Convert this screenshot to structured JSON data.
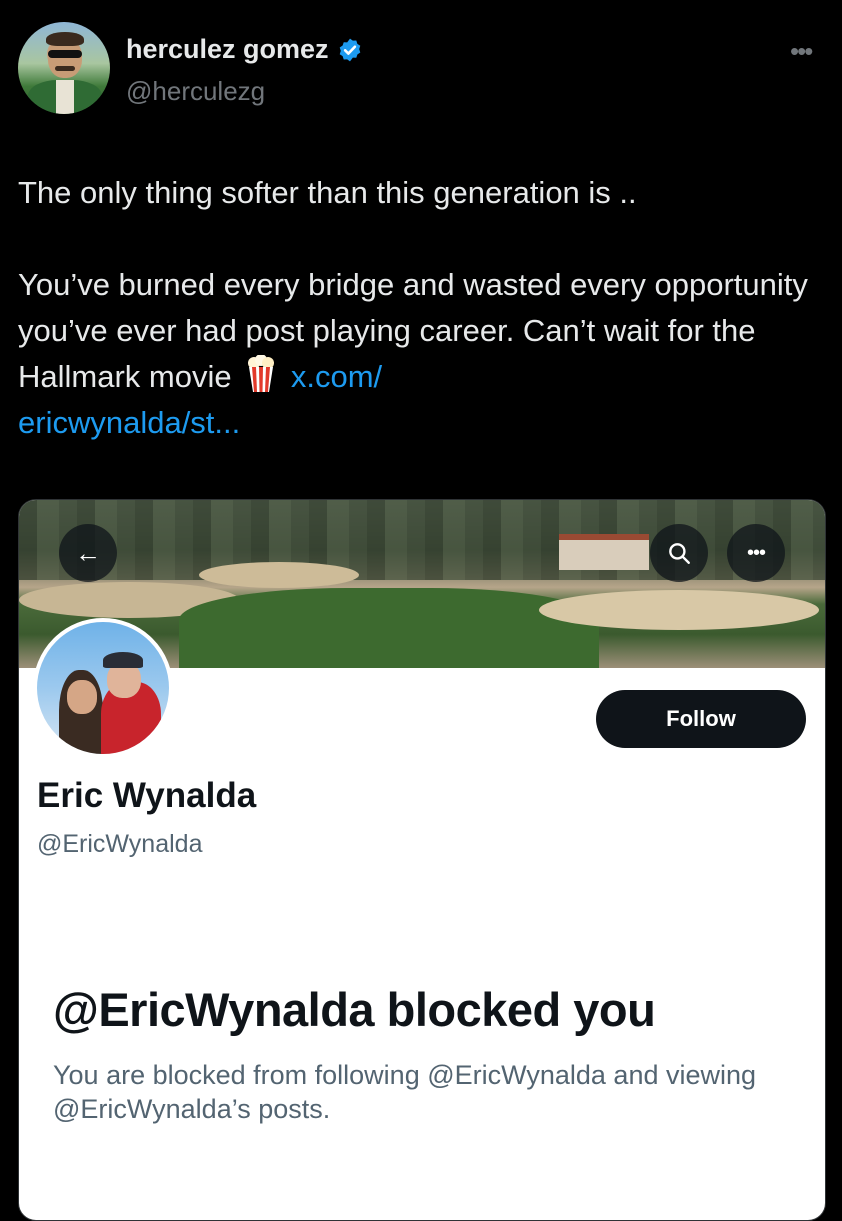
{
  "author": {
    "display_name": "herculez gomez",
    "handle": "@herculezg",
    "verified": true,
    "avatar_icon": "profile-photo"
  },
  "tweet": {
    "line1": "The only thing softer than this generation is  ..",
    "line2": "You’ve burned every bridge and wasted every opportunity you’ve ever had post playing career. Can’t wait for the Hallmark movie",
    "emoji": "🍿",
    "link_text_1": "x.com/",
    "link_text_2": "ericwynalda/st..."
  },
  "card": {
    "profile_name": "Eric Wynalda",
    "profile_handle": "@EricWynalda",
    "follow_label": "Follow",
    "blocked_title": "@EricWynalda blocked you",
    "blocked_desc": "You are blocked from following @EricWynalda and viewing @EricWynalda’s posts."
  },
  "colors": {
    "background": "#000000",
    "text": "#e7e9ea",
    "secondary": "#71767b",
    "link": "#1d9bf0",
    "verified": "#1d9bf0",
    "card_bg": "#ffffff"
  }
}
